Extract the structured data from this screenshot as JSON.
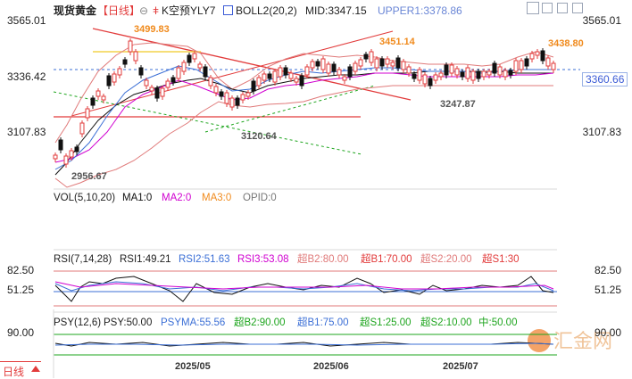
{
  "header": {
    "symbol": "现货黄金",
    "period_bracket": "【日线】",
    "contract": "K空预YLY7",
    "indicator": "BOLL2(20,2)",
    "mid": "MID:3347.15",
    "upper": "UPPER1:3378.86"
  },
  "price_axis": {
    "right_labels": [
      "3565.01",
      "3336.42",
      "3107.83"
    ],
    "left_labels": [
      "3565.01",
      "3336.42",
      "3107.83"
    ],
    "current_price": "3360.66"
  },
  "annotations": {
    "high1": "3499.83",
    "high2": "3451.14",
    "high3": "3438.80",
    "low1": "2956.67",
    "low2": "3120.64",
    "low3": "3247.87"
  },
  "vol_panel": {
    "title": "VOL(5,10,20)",
    "ma1": "MA1:0",
    "ma2": "MA2:0",
    "ma3": "MA3:0",
    "opid": "OPID:0"
  },
  "rsi_panel": {
    "title": "RSI(7,14,28)",
    "rsi1": "RSI1:49.21",
    "rsi2": "RSI2:51.63",
    "rsi3": "RSI3:53.08",
    "b2": "超B2:80.00",
    "b1": "超B1:70.00",
    "s2": "超S2:20.00",
    "s1": "超S1:30",
    "axis": [
      "82.50",
      "51.25"
    ]
  },
  "psy_panel": {
    "title": "PSY(12,6)",
    "psy": "PSY:50.00",
    "psyma": "PSYMA:55.56",
    "b2": "超B2:90.00",
    "b1": "超B1:75.00",
    "s1": "超S1:25.00",
    "s2": "超S2:10.00",
    "mid": "中:50.00",
    "axis": [
      "90.00"
    ]
  },
  "dates": [
    "2025/05",
    "2025/06",
    "2025/07"
  ],
  "period_tab": "日线",
  "watermark": "汇金网",
  "colors": {
    "up": "#e23b3b",
    "down": "#111111",
    "boll_upper": "#e07a7a",
    "boll_mid": "#111111",
    "boll_lower": "#3b6fd6",
    "ma_magenta": "#d000d0",
    "ma_green": "#1ea51e",
    "rsi_blue": "#3b6fd6",
    "label_orange": "#f08a1c",
    "header_blue": "#3b5bd6"
  }
}
